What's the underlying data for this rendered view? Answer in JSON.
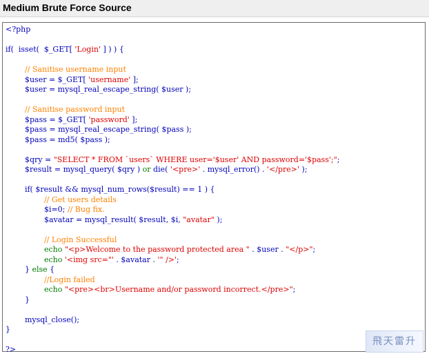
{
  "header": {
    "title": "Medium Brute Force Source"
  },
  "colors": {
    "default": "#0000bb",
    "keyword": "#007700",
    "string": "#dd0000",
    "comment": "#ff8000",
    "php_tag": "#0000bb"
  },
  "code": {
    "lines": [
      [
        [
          "t",
          "<?php"
        ]
      ],
      [],
      [
        [
          "d",
          "if( "
        ],
        [
          "d",
          " isset( "
        ],
        [
          "d",
          " $_GET[ "
        ],
        [
          "s",
          "'Login'"
        ],
        [
          "d",
          " ] ) ) {"
        ]
      ],
      [],
      [
        [
          "d",
          "        "
        ],
        [
          "c",
          "// Sanitise username input"
        ]
      ],
      [
        [
          "d",
          "        $user = $_GET[ "
        ],
        [
          "s",
          "'username'"
        ],
        [
          "d",
          " ];"
        ]
      ],
      [
        [
          "d",
          "        $user = mysql_real_escape_string( $user );"
        ]
      ],
      [],
      [
        [
          "d",
          "        "
        ],
        [
          "c",
          "// Sanitise password input"
        ]
      ],
      [
        [
          "d",
          "        $pass = $_GET[ "
        ],
        [
          "s",
          "'password'"
        ],
        [
          "d",
          " ];"
        ]
      ],
      [
        [
          "d",
          "        $pass = mysql_real_escape_string( $pass );"
        ]
      ],
      [
        [
          "d",
          "        $pass = md5( $pass );"
        ]
      ],
      [],
      [
        [
          "d",
          "        $qry = "
        ],
        [
          "s",
          "\"SELECT * FROM `users` WHERE user='$user' AND password='$pass';\""
        ],
        [
          "d",
          ";"
        ]
      ],
      [
        [
          "d",
          "        $result = mysql_query( $qry ) "
        ],
        [
          "k",
          "or"
        ],
        [
          "d",
          " die( "
        ],
        [
          "s",
          "'<pre>'"
        ],
        [
          "d",
          " . mysql_error() . "
        ],
        [
          "s",
          "'</pre>'"
        ],
        [
          "d",
          " );"
        ]
      ],
      [],
      [
        [
          "d",
          "        if( $result && mysql_num_rows($result) == 1 ) {"
        ]
      ],
      [
        [
          "d",
          "                "
        ],
        [
          "c",
          "// Get users details"
        ]
      ],
      [
        [
          "d",
          "                $i=0; "
        ],
        [
          "c",
          "// Bug fix."
        ]
      ],
      [
        [
          "d",
          "                $avatar = mysql_result( $result, $i, "
        ],
        [
          "s",
          "\"avatar\""
        ],
        [
          "d",
          " );"
        ]
      ],
      [],
      [
        [
          "d",
          "                "
        ],
        [
          "c",
          "// Login Successful"
        ]
      ],
      [
        [
          "d",
          "                "
        ],
        [
          "k",
          "echo"
        ],
        [
          "d",
          " "
        ],
        [
          "s",
          "\"<p>Welcome to the password protected area \""
        ],
        [
          "d",
          " . $user . "
        ],
        [
          "s",
          "\"</p>\""
        ],
        [
          "d",
          ";"
        ]
      ],
      [
        [
          "d",
          "                "
        ],
        [
          "k",
          "echo"
        ],
        [
          "d",
          " "
        ],
        [
          "s",
          "'<img src=\"'"
        ],
        [
          "d",
          " . $avatar . "
        ],
        [
          "s",
          "'\" />'"
        ],
        [
          "d",
          ";"
        ]
      ],
      [
        [
          "d",
          "        } "
        ],
        [
          "k",
          "else"
        ],
        [
          "d",
          " {"
        ]
      ],
      [
        [
          "d",
          "                "
        ],
        [
          "c",
          "//Login failed"
        ]
      ],
      [
        [
          "d",
          "                "
        ],
        [
          "k",
          "echo"
        ],
        [
          "d",
          " "
        ],
        [
          "s",
          "\"<pre><br>Username and/or password incorrect.</pre>\""
        ],
        [
          "d",
          ";"
        ]
      ],
      [
        [
          "d",
          "        }"
        ]
      ],
      [],
      [
        [
          "d",
          "        mysql_close();"
        ]
      ],
      [
        [
          "d",
          "}"
        ]
      ],
      [],
      [
        [
          "t",
          "?>"
        ]
      ]
    ]
  },
  "watermark": {
    "text": "飛天雷升"
  }
}
